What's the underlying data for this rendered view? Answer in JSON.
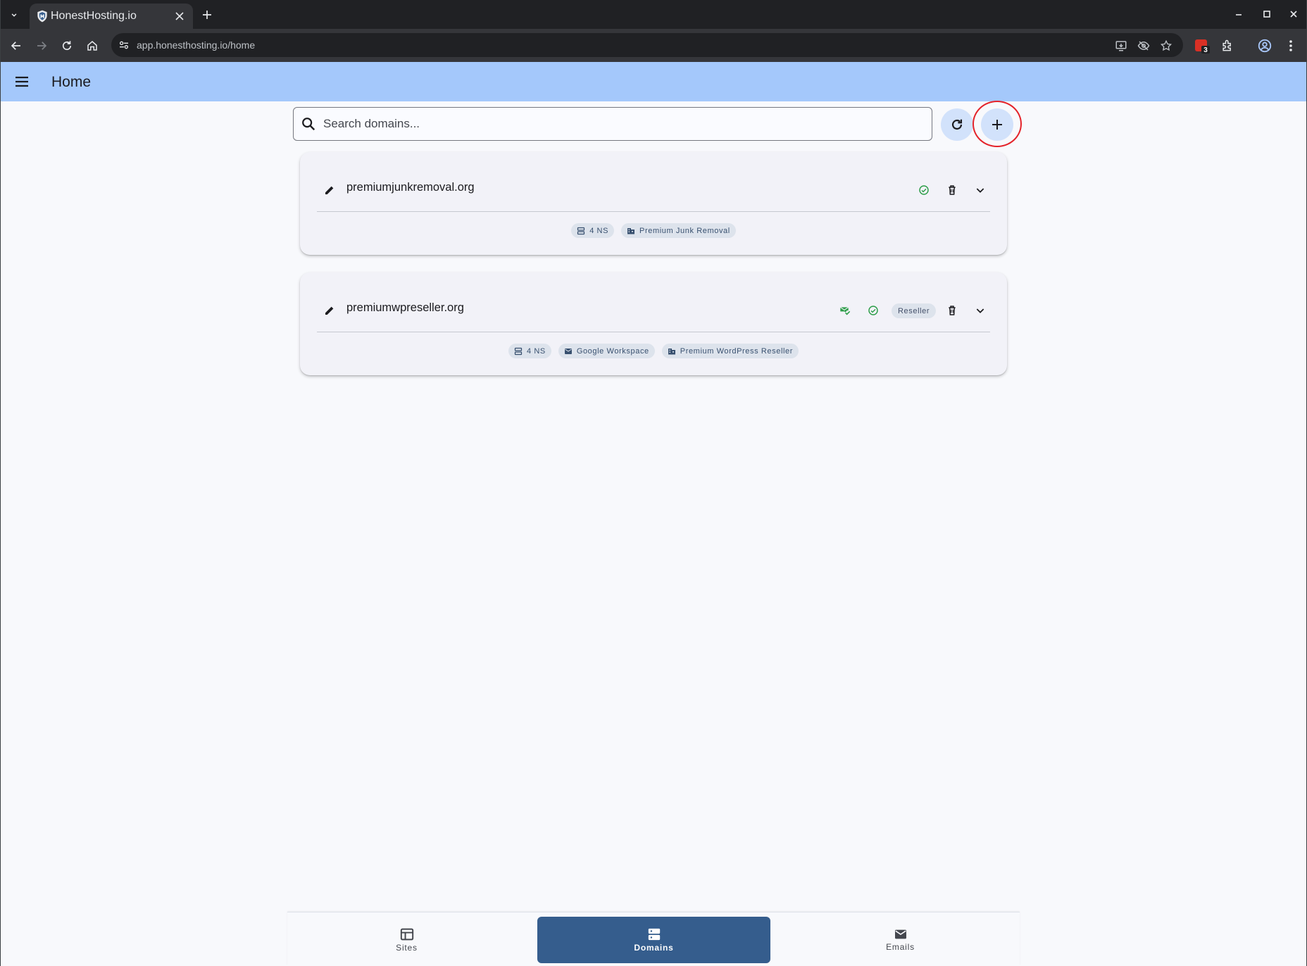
{
  "browser": {
    "tab_title": "HonestHosting.io",
    "url": "app.honesthosting.io/home",
    "extension_badge": "3"
  },
  "app": {
    "title": "Home",
    "search_placeholder": "Search domains..."
  },
  "domains": [
    {
      "name": "premiumjunkremoval.org",
      "status_icons": [
        "check-circle-icon"
      ],
      "role": "",
      "chips": [
        {
          "icon": "dns-icon",
          "label": "4 NS"
        },
        {
          "icon": "business-icon",
          "label": "Premium Junk Removal"
        }
      ]
    },
    {
      "name": "premiumwpreseller.org",
      "status_icons": [
        "mark-email-read-icon",
        "check-circle-icon"
      ],
      "role": "Reseller",
      "chips": [
        {
          "icon": "dns-icon",
          "label": "4 NS"
        },
        {
          "icon": "mail-icon",
          "label": "Google Workspace"
        },
        {
          "icon": "business-icon",
          "label": "Premium WordPress Reseller"
        }
      ]
    }
  ],
  "bottom_nav": {
    "items": [
      {
        "label": "Sites",
        "icon": "web-icon",
        "active": false
      },
      {
        "label": "Domains",
        "icon": "dns-icon",
        "active": true
      },
      {
        "label": "Emails",
        "icon": "mail-icon",
        "active": false
      }
    ]
  },
  "colors": {
    "app_bar": "#a4c8fb",
    "accent": "#355d8d",
    "success": "#2e9e4a"
  }
}
